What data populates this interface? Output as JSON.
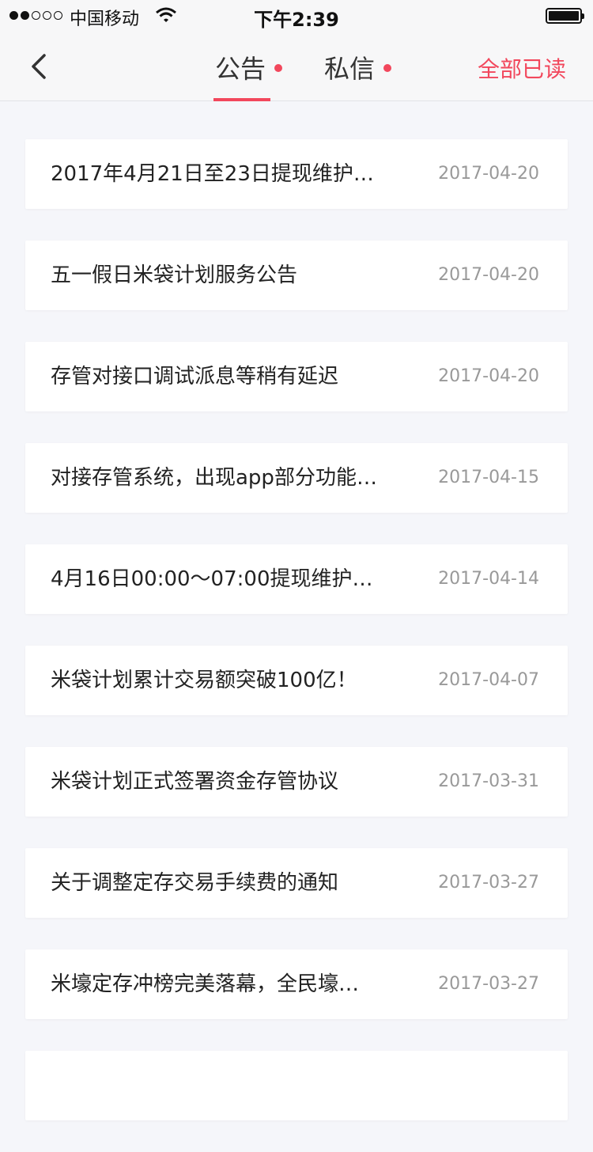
{
  "status_bar": {
    "carrier": "中国移动",
    "time": "下午2:39",
    "signal_strength": 2
  },
  "nav": {
    "tabs": [
      {
        "label": "公告",
        "active": true,
        "has_unread": true
      },
      {
        "label": "私信",
        "active": false,
        "has_unread": true
      }
    ],
    "mark_all_read_label": "全部已读",
    "accent_color": "#f2475c"
  },
  "notices": [
    {
      "title": "2017年4月21日至23日提现维护…",
      "date": "2017-04-20"
    },
    {
      "title": "五一假日米袋计划服务公告",
      "date": "2017-04-20"
    },
    {
      "title": "存管对接口调试派息等稍有延迟",
      "date": "2017-04-20"
    },
    {
      "title": "对接存管系统，出现app部分功能…",
      "date": "2017-04-15"
    },
    {
      "title": "4月16日00:00～07:00提现维护…",
      "date": "2017-04-14"
    },
    {
      "title": "米袋计划累计交易额突破100亿！",
      "date": "2017-04-07"
    },
    {
      "title": "米袋计划正式签署资金存管协议",
      "date": "2017-03-31"
    },
    {
      "title": "关于调整定存交易手续费的通知",
      "date": "2017-03-27"
    },
    {
      "title": "米壕定存冲榜完美落幕，全民壕…",
      "date": "2017-03-27"
    },
    {
      "title": "",
      "date": ""
    }
  ]
}
